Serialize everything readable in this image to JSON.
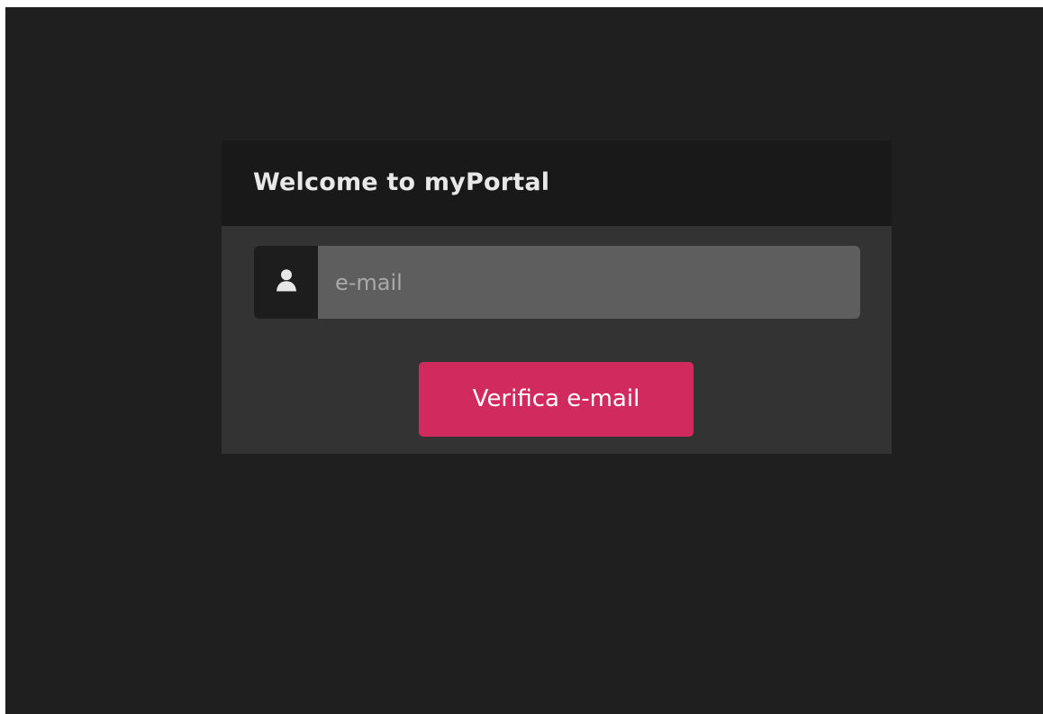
{
  "app": {
    "title": "Welcome to myPortal"
  },
  "login_form": {
    "email_icon": "user-icon",
    "email_placeholder": "e-mail",
    "email_value": "",
    "verify_button_label": "Verifica e-mail"
  },
  "colors": {
    "page_background": "#1f1f1f",
    "header_background": "#191919",
    "card_background": "#333333",
    "input_background": "#5e5e5e",
    "primary_button": "#d12a5f",
    "title_text": "#e8e8e8"
  }
}
